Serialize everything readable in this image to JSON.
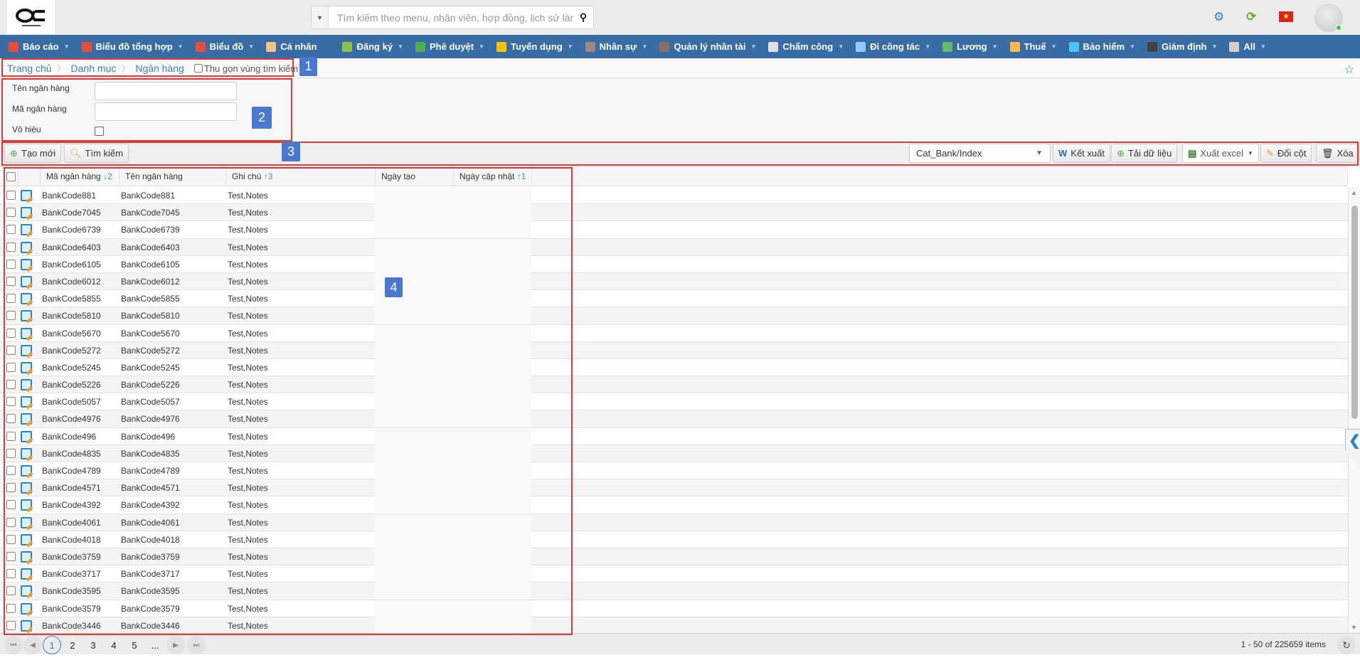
{
  "header": {
    "search_placeholder": "Tìm kiếm theo menu, nhân viên, hợp đồng, lịch sử làm việc",
    "icons": [
      "gear-icon",
      "sync-icon",
      "vietnam-flag-icon",
      "avatar"
    ]
  },
  "nav": [
    {
      "label": "Báo cáo",
      "color": "#e84c3d",
      "caret": true
    },
    {
      "label": "Biểu đồ tổng hợp",
      "color": "#e84c3d",
      "caret": true
    },
    {
      "label": "Biểu đồ",
      "color": "#e84c3d",
      "caret": true
    },
    {
      "label": "Cá nhân",
      "color": "#f5c28a",
      "caret": false
    },
    {
      "label": "Đăng ký",
      "color": "#8bc34a",
      "caret": true
    },
    {
      "label": "Phê duyệt",
      "color": "#4caf50",
      "caret": true
    },
    {
      "label": "Tuyển dụng",
      "color": "#ffc107",
      "caret": true
    },
    {
      "label": "Nhân sự",
      "color": "#a1887f",
      "caret": true
    },
    {
      "label": "Quản lý nhân tài",
      "color": "#8d6e63",
      "caret": true
    },
    {
      "label": "Chấm công",
      "color": "#e0e0e0",
      "caret": true
    },
    {
      "label": "Đi công tác",
      "color": "#90caf9",
      "caret": true
    },
    {
      "label": "Lương",
      "color": "#66bb6a",
      "caret": true
    },
    {
      "label": "Thuế",
      "color": "#ffb74d",
      "caret": true
    },
    {
      "label": "Bảo hiểm",
      "color": "#4fc3f7",
      "caret": true
    },
    {
      "label": "Giám định",
      "color": "#424242",
      "caret": true
    },
    {
      "label": "All",
      "color": "#d7ccc8",
      "caret": true
    }
  ],
  "breadcrumb": {
    "home": "Trang chủ",
    "category": "Danh mục",
    "current": "Ngân hàng",
    "collapse_label": "Thu gọn vùng tìm kiếm"
  },
  "form": {
    "bank_name_label": "Tên ngân hàng",
    "bank_code_label": "Mã ngân hàng",
    "disabled_label": "Vô hiệu"
  },
  "toolbar": {
    "create": "Tạo mới",
    "search": "Tìm kiếm",
    "template": "Cat_Bank/Index",
    "export": "Kết xuất",
    "load": "Tải dữ liệu",
    "excel": "Xuất excel",
    "columns": "Đổi cột",
    "delete": "Xóa"
  },
  "grid": {
    "columns": {
      "code": "Mã ngân hàng",
      "code_sort": "↓2",
      "name": "Tên ngân hàng",
      "note": "Ghi chú",
      "note_sort": "↑3",
      "created": "Ngày tạo",
      "updated": "Ngày cập nhật",
      "updated_sort": "↑1"
    },
    "rows": [
      {
        "code": "BankCode881",
        "name": "BankCode881",
        "note": "Test,Notes"
      },
      {
        "code": "BankCode7045",
        "name": "BankCode7045",
        "note": "Test,Notes"
      },
      {
        "code": "BankCode6739",
        "name": "BankCode6739",
        "note": "Test,Notes"
      },
      {
        "code": "BankCode6403",
        "name": "BankCode6403",
        "note": "Test,Notes"
      },
      {
        "code": "BankCode6105",
        "name": "BankCode6105",
        "note": "Test,Notes"
      },
      {
        "code": "BankCode6012",
        "name": "BankCode6012",
        "note": "Test,Notes"
      },
      {
        "code": "BankCode5855",
        "name": "BankCode5855",
        "note": "Test,Notes"
      },
      {
        "code": "BankCode5810",
        "name": "BankCode5810",
        "note": "Test,Notes"
      },
      {
        "code": "BankCode5670",
        "name": "BankCode5670",
        "note": "Test,Notes"
      },
      {
        "code": "BankCode5272",
        "name": "BankCode5272",
        "note": "Test,Notes"
      },
      {
        "code": "BankCode5245",
        "name": "BankCode5245",
        "note": "Test,Notes"
      },
      {
        "code": "BankCode5226",
        "name": "BankCode5226",
        "note": "Test,Notes"
      },
      {
        "code": "BankCode5057",
        "name": "BankCode5057",
        "note": "Test,Notes"
      },
      {
        "code": "BankCode4976",
        "name": "BankCode4976",
        "note": "Test,Notes"
      },
      {
        "code": "BankCode496",
        "name": "BankCode496",
        "note": "Test,Notes"
      },
      {
        "code": "BankCode4835",
        "name": "BankCode4835",
        "note": "Test,Notes"
      },
      {
        "code": "BankCode4789",
        "name": "BankCode4789",
        "note": "Test,Notes"
      },
      {
        "code": "BankCode4571",
        "name": "BankCode4571",
        "note": "Test,Notes"
      },
      {
        "code": "BankCode4392",
        "name": "BankCode4392",
        "note": "Test,Notes"
      },
      {
        "code": "BankCode4061",
        "name": "BankCode4061",
        "note": "Test,Notes"
      },
      {
        "code": "BankCode4018",
        "name": "BankCode4018",
        "note": "Test,Notes"
      },
      {
        "code": "BankCode3759",
        "name": "BankCode3759",
        "note": "Test,Notes"
      },
      {
        "code": "BankCode3717",
        "name": "BankCode3717",
        "note": "Test,Notes"
      },
      {
        "code": "BankCode3595",
        "name": "BankCode3595",
        "note": "Test,Notes"
      },
      {
        "code": "BankCode3579",
        "name": "BankCode3579",
        "note": "Test,Notes"
      },
      {
        "code": "BankCode3446",
        "name": "BankCode3446",
        "note": "Test,Notes"
      }
    ]
  },
  "pager": {
    "pages": [
      "1",
      "2",
      "3",
      "4",
      "5",
      "..."
    ],
    "current": "1",
    "info": "1 - 50 of 225659 items"
  },
  "annotations": [
    "1",
    "2",
    "3",
    "4"
  ],
  "colors": {
    "nav": "#386ca5",
    "link": "#3a80c4",
    "annotation": "#e53935",
    "annotation_label": "#4a78d0"
  }
}
